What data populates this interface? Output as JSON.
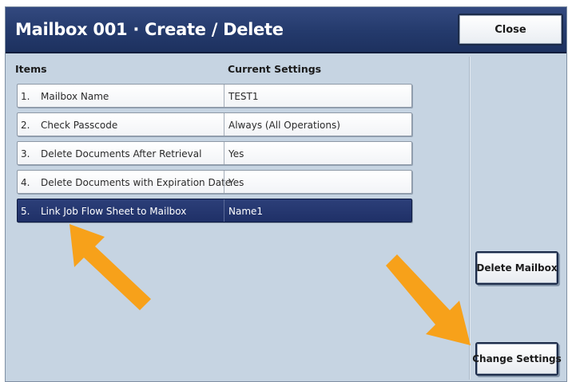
{
  "window": {
    "title": "Mailbox 001 · Create / Delete",
    "close_label": "Close"
  },
  "columns": {
    "items": "Items",
    "current_settings": "Current Settings"
  },
  "rows": [
    {
      "number": "1.",
      "item": "Mailbox Name",
      "value": "TEST1",
      "selected": false
    },
    {
      "number": "2.",
      "item": "Check Passcode",
      "value": "Always (All Operations)",
      "selected": false
    },
    {
      "number": "3.",
      "item": "Delete Documents After Retrieval",
      "value": "Yes",
      "selected": false
    },
    {
      "number": "4.",
      "item": "Delete Documents with Expiration Date",
      "value": "Yes",
      "selected": false
    },
    {
      "number": "5.",
      "item": "Link Job Flow Sheet to Mailbox",
      "value": "Name1",
      "selected": true
    }
  ],
  "side_buttons": {
    "delete_label": "Delete Mailbox",
    "change_label": "Change Settings"
  },
  "colors": {
    "title_bar": "#243a6c",
    "selected_row": "#1f3067",
    "background": "#c6d4e2",
    "annotation_arrow": "#f7a11a"
  },
  "annotations": [
    "arrow-icon",
    "arrow-icon"
  ]
}
